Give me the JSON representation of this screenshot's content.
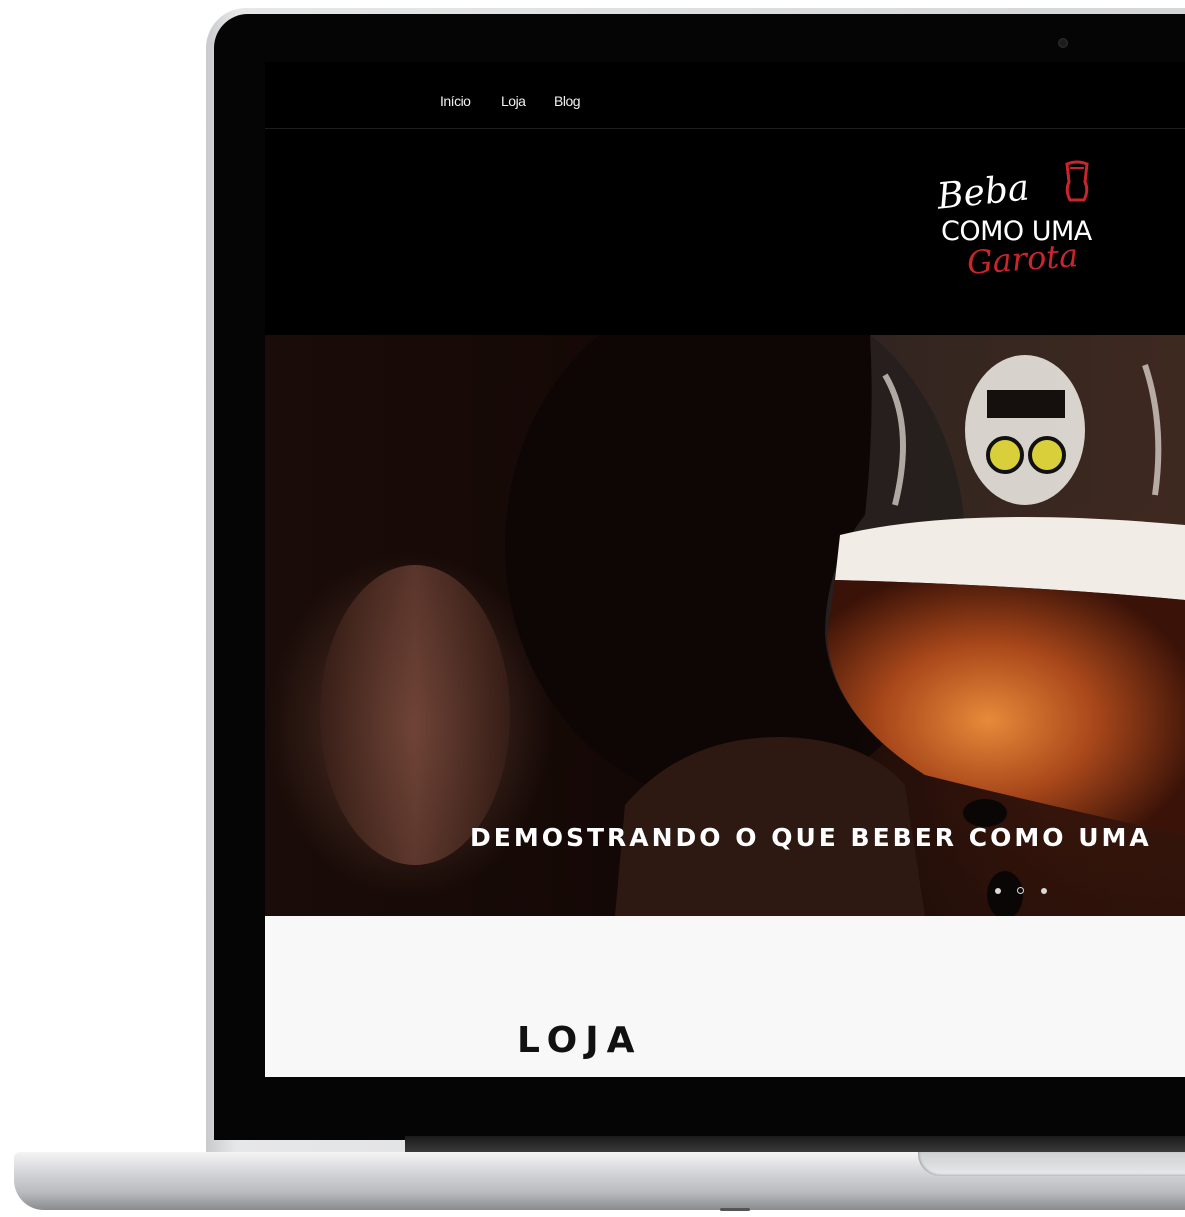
{
  "nav": {
    "items": [
      {
        "label": "Início"
      },
      {
        "label": "Loja"
      },
      {
        "label": "Blog"
      }
    ]
  },
  "logo": {
    "line1": "Beba",
    "line2": "COMO UMA",
    "line3": "Garota",
    "accent_color": "#c8262a"
  },
  "hero": {
    "caption": "DEMOSTRANDO O QUE BEBER COMO UMA",
    "slides": 3,
    "active_slide": 2
  },
  "section": {
    "title": "LOJA"
  },
  "colors": {
    "screen_bg": "#000000",
    "section_bg": "#f8f8f8",
    "beer": "#c25a1c"
  }
}
